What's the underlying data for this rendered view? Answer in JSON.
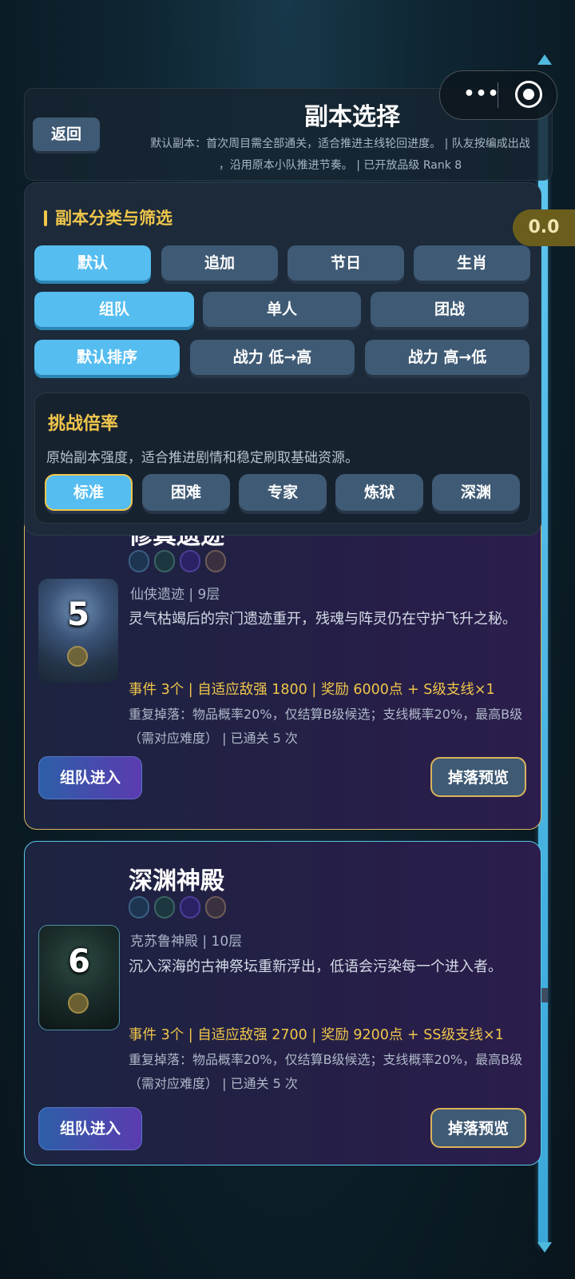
{
  "header": {
    "back_label": "返回",
    "title": "副本选择",
    "desc_line1": "默认副本：首次周目需全部通关，适合推进主线轮回进度。 | 队友按编成出战",
    "desc_line2": "，沿用原本小队推进节奏。 | 已开放品级 Rank 8"
  },
  "score_badge": "0.0",
  "capsule": {
    "dots": "•••"
  },
  "filters": {
    "section_title": "副本分类与筛选",
    "category": [
      "默认",
      "追加",
      "节日",
      "生肖"
    ],
    "mode": [
      "组队",
      "单人",
      "团战"
    ],
    "sort": [
      "默认排序",
      "战力 低→高",
      "战力 高→低"
    ],
    "selected": {
      "category": "默认",
      "mode": "组队",
      "sort": "默认排序",
      "rate": "标准"
    }
  },
  "challenge": {
    "title": "挑战倍率",
    "desc": "原始副本强度，适合推进剧情和稳定刷取基础资源。",
    "rates": [
      "标准",
      "困难",
      "专家",
      "炼狱",
      "深渊"
    ]
  },
  "dungeons": [
    {
      "title": "修真遗迹",
      "number": "5",
      "location": "仙侠遗迹 | 9层",
      "story": "灵气枯竭后的宗门遗迹重开，残魂与阵灵仍在守护飞升之秘。",
      "reward": "事件 3个 | 自适应敌强 1800 | 奖励 6000点 + S级支线×1",
      "drop": "重复掉落：物品概率20%，仅结算B级候选；支线概率20%，最高B级（需对应难度） | 已通关 5 次",
      "team_label": "组队进入",
      "preview_label": "掉落预览"
    },
    {
      "title": "深渊神殿",
      "number": "6",
      "location": "克苏鲁神殿 | 10层",
      "story": "沉入深海的古神祭坛重新浮出，低语会污染每一个进入者。",
      "reward": "事件 3个 | 自适应敌强 2700 | 奖励 9200点 + SS级支线×1",
      "drop": "重复掉落：物品概率20%，仅结算B级候选；支线概率20%，最高B级（需对应难度） | 已通关 5 次",
      "team_label": "组队进入",
      "preview_label": "掉落预览"
    }
  ],
  "colors": {
    "accent": "#55bdf0",
    "gold": "#f0c64b",
    "button": "#3f5a74"
  }
}
